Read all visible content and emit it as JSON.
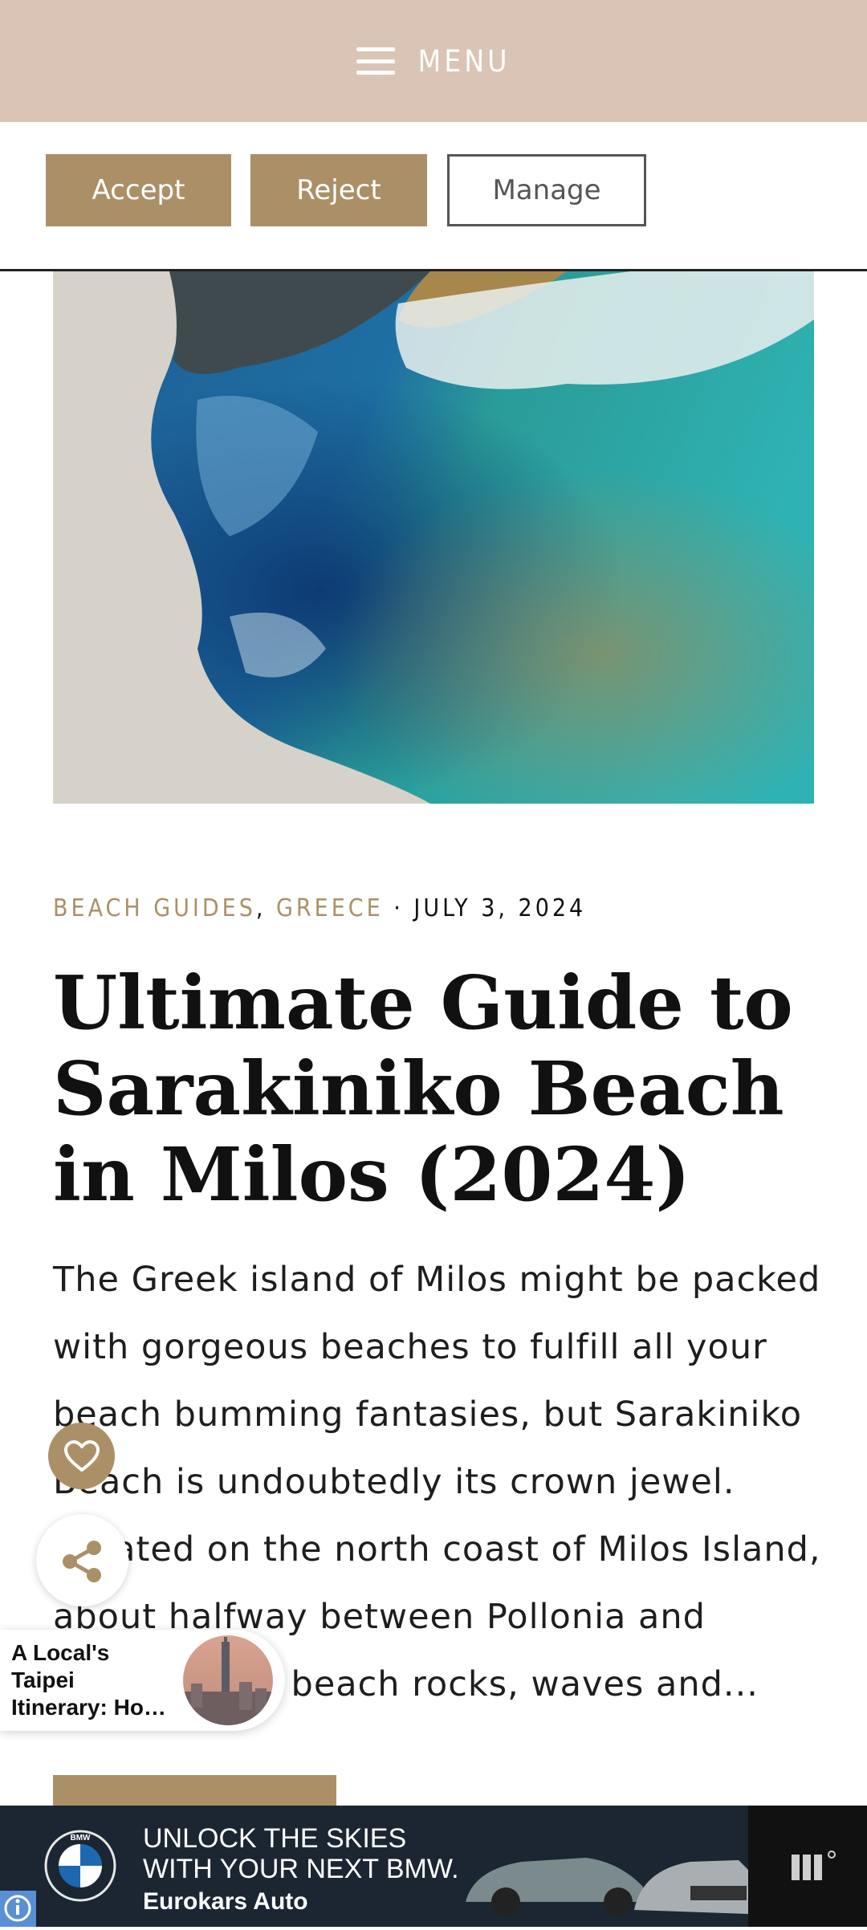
{
  "menu": {
    "label": "MENU"
  },
  "consent": {
    "accept": "Accept",
    "reject": "Reject",
    "manage": "Manage"
  },
  "post": {
    "categories": [
      "BEACH GUIDES",
      "GREECE"
    ],
    "category_separator": ",",
    "meta_separator": "·",
    "date": "JULY 3, 2024",
    "title": "Ultimate Guide to Sarakiniko Beach in Milos (2024)",
    "excerpt": "The Greek island of Milos might be packed with gorgeous beaches to fulfill all your beach bumming fantasies, but Sarakiniko Beach is undoubtedly its crown jewel. Located on the north coast of Milos Island, about halfway between Pollonia and Adamas, the beach rocks, waves and..."
  },
  "recommendation": {
    "text": "A Local's\nTaipei\nItinerary: Ho…"
  },
  "ad": {
    "headline_line1": "UNLOCK THE SKIES",
    "headline_line2": "WITH YOUR NEXT BMW.",
    "dealer": "Eurokars Auto",
    "brand_letters": "BMW"
  },
  "icons": {
    "menu": "hamburger-icon",
    "favorite": "heart-icon",
    "share": "share-icon",
    "ad_brand": "bmw-logo-icon",
    "ad_network": "ad-network-icon",
    "ad_info": "ad-info-icon"
  },
  "colors": {
    "accent": "#ab9067",
    "top_bar": "#dac4b6",
    "ad_bg": "#1b2632"
  }
}
